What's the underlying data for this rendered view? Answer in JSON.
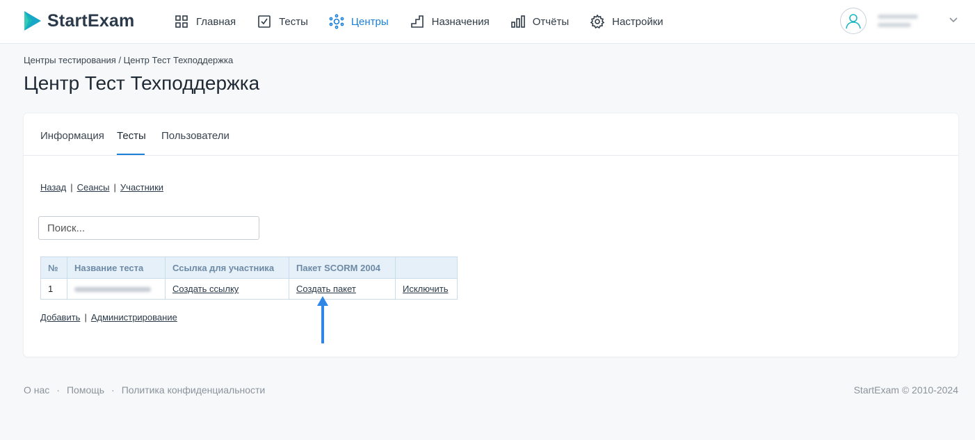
{
  "brand": {
    "name": "StartExam",
    "color": "#19a7c9"
  },
  "nav": [
    {
      "label": "Главная",
      "icon": "grid-icon"
    },
    {
      "label": "Тесты",
      "icon": "checkbox-icon"
    },
    {
      "label": "Центры",
      "icon": "network-icon",
      "active": true
    },
    {
      "label": "Назначения",
      "icon": "steps-icon"
    },
    {
      "label": "Отчёты",
      "icon": "bar-chart-icon"
    },
    {
      "label": "Настройки",
      "icon": "gear-icon"
    }
  ],
  "breadcrumb": "Центры тестирования / Центр Тест Техподдержка",
  "page_title": "Центр Тест Техподдержка",
  "tabs": [
    "Информация",
    "Тесты",
    "Пользователи"
  ],
  "active_tab": "Тесты",
  "top_links": [
    "Назад",
    "Сеансы",
    "Участники"
  ],
  "search": {
    "placeholder": "Поиск..."
  },
  "table": {
    "headers": [
      "№",
      "Название теста",
      "Ссылка для участника",
      "Пакет SCORM 2004",
      ""
    ],
    "rows": [
      {
        "num": "1",
        "create_link": "Создать ссылку",
        "create_package": "Создать пакет",
        "exclude": "Исключить"
      }
    ]
  },
  "bottom_links": [
    "Добавить",
    "Администрирование"
  ],
  "footer": {
    "links": [
      "О нас",
      "Помощь",
      "Политика конфиденциальности"
    ],
    "copyright": "StartExam © 2010-2024"
  },
  "accent_color": "#1a7fd6",
  "arrow_color": "#2f86e6"
}
